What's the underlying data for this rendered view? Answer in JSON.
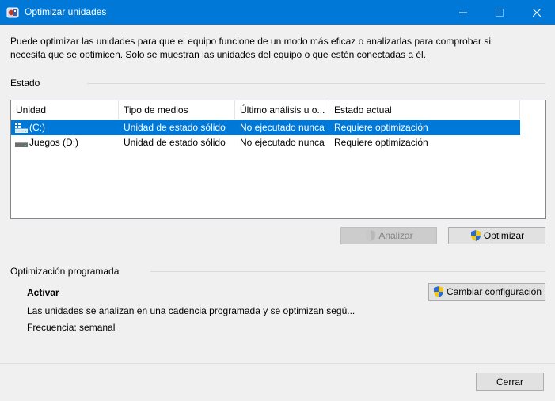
{
  "window": {
    "title": "Optimizar unidades",
    "accent_color": "#0078d7"
  },
  "intro_text": "Puede optimizar las unidades para que el equipo funcione de un modo más eficaz o analizarlas para comprobar si necesita que se optimicen. Solo se muestran las unidades del equipo o que estén conectadas a él.",
  "status": {
    "group_label": "Estado",
    "columns": [
      "Unidad",
      "Tipo de medios",
      "Último análisis u o...",
      "Estado actual"
    ],
    "drives": [
      {
        "name": "(C:)",
        "media": "Unidad de estado sólido",
        "last_run": "No ejecutado nunca",
        "state": "Requiere optimización",
        "selected": true,
        "icon": "windows-drive-icon"
      },
      {
        "name": "Juegos (D:)",
        "media": "Unidad de estado sólido",
        "last_run": "No ejecutado nunca",
        "state": "Requiere optimización",
        "selected": false,
        "icon": "drive-icon"
      }
    ],
    "analyze_label": "Analizar",
    "optimize_label": "Optimizar"
  },
  "scheduled": {
    "group_label": "Optimización programada",
    "status": "Activar",
    "description": "Las unidades se analizan en una cadencia programada y se optimizan segú...",
    "frequency": "Frecuencia: semanal",
    "change_label": "Cambiar configuración"
  },
  "footer": {
    "close_label": "Cerrar"
  }
}
